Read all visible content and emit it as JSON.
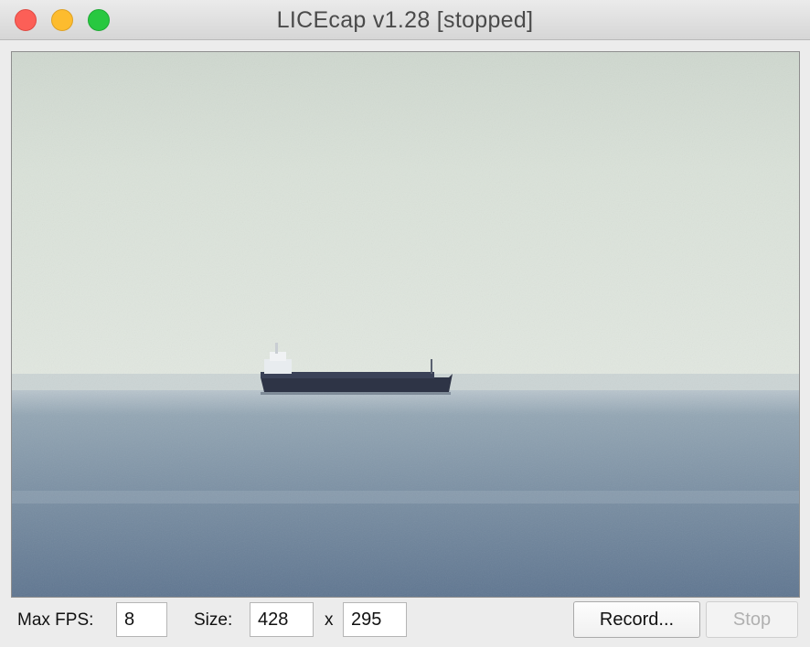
{
  "window": {
    "title": "LICEcap v1.28 [stopped]"
  },
  "controls": {
    "max_fps_label": "Max FPS:",
    "max_fps_value": "8",
    "size_label": "Size:",
    "width_value": "428",
    "separator": "x",
    "height_value": "295",
    "record_label": "Record...",
    "stop_label": "Stop"
  },
  "colors": {
    "close": "#fc5f57",
    "minimize": "#fdbc2e",
    "maximize": "#28c840",
    "sky": "#dde4dc",
    "sea": "#6f8599",
    "ship_hull": "#2e3446"
  }
}
